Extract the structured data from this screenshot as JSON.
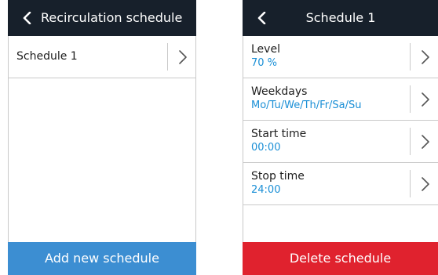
{
  "left_screen": {
    "title": "Recirculation schedule",
    "items": [
      {
        "label": "Schedule 1"
      }
    ],
    "footer_button": "Add new schedule",
    "footer_color": "#3c8ed2"
  },
  "right_screen": {
    "title": "Schedule 1",
    "items": [
      {
        "label": "Level",
        "value": "70 %"
      },
      {
        "label": "Weekdays",
        "value": "Mo/Tu/We/Th/Fr/Sa/Su"
      },
      {
        "label": "Start time",
        "value": "00:00"
      },
      {
        "label": "Stop time",
        "value": "24:00"
      }
    ],
    "footer_button": "Delete schedule",
    "footer_color": "#e0222e"
  },
  "colors": {
    "header_bg": "#17202b",
    "value_text": "#1a8fd6",
    "separator": "#c9c9c9"
  },
  "icons": {
    "back": "chevron-left-icon",
    "row_arrow": "chevron-right-icon"
  }
}
